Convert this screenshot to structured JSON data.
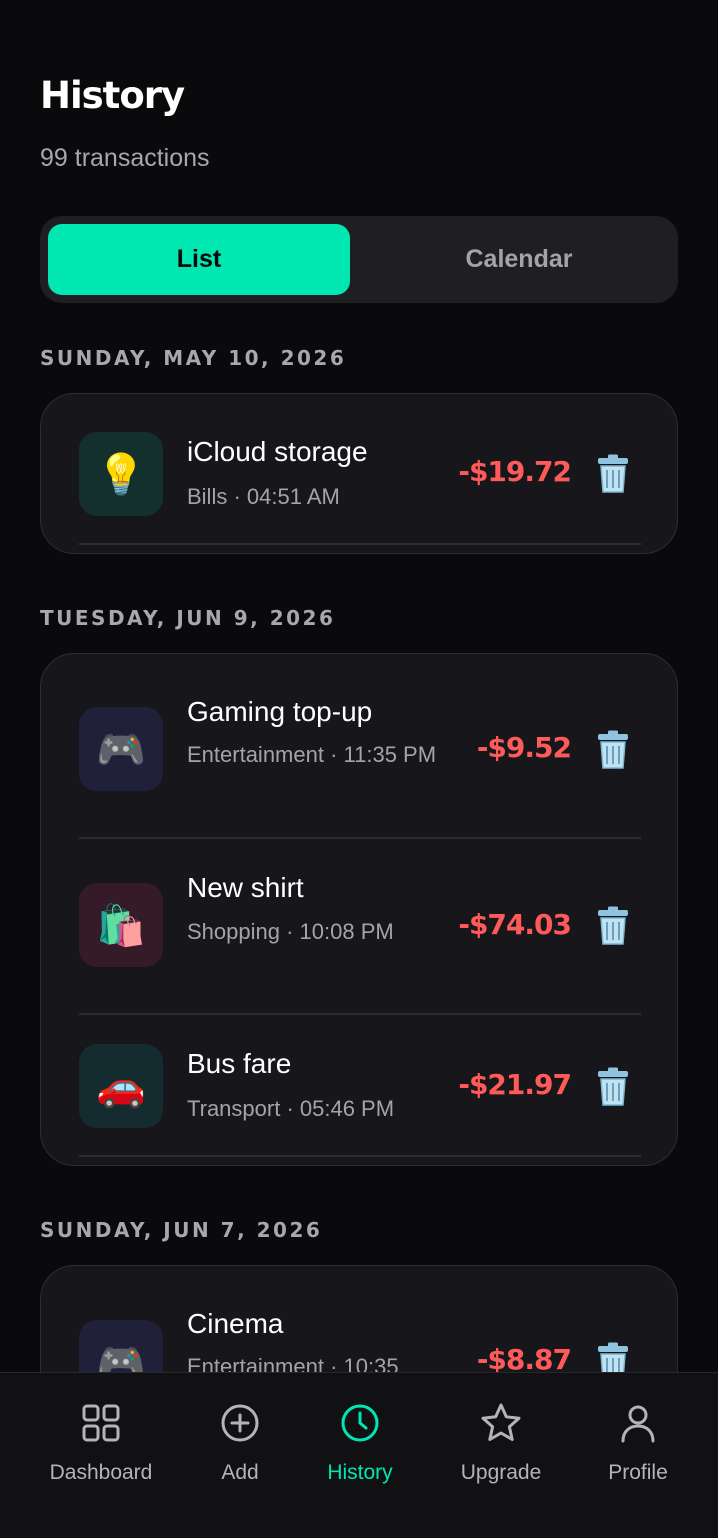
{
  "header": {
    "title": "History",
    "count": "99 transactions"
  },
  "view_toggle": {
    "list_label": "List",
    "calendar_label": "Calendar",
    "selected": "List"
  },
  "groups": [
    {
      "date": "SUNDAY, MAY 10, 2026",
      "items": [
        {
          "icon": "lightbulb-icon",
          "emoji": "💡",
          "title": "iCloud storage",
          "category": "Bills",
          "time": "04:51 AM",
          "subtitle": "Bills · 04:51 AM",
          "amount": "-$19.72"
        }
      ]
    },
    {
      "date": "TUESDAY, JUN 9, 2026",
      "items": [
        {
          "icon": "game-controller-icon",
          "emoji": "🎮",
          "title": "Gaming top-up",
          "category": "Entertainment",
          "time": "11:35 PM",
          "subtitle": "Entertainment · 11:35 PM",
          "amount": "-$9.52"
        },
        {
          "icon": "shopping-bags-icon",
          "emoji": "🛍️",
          "title": "New shirt",
          "category": "Shopping",
          "time": "10:08 PM",
          "subtitle": "Shopping · 10:08 PM",
          "amount": "-$74.03"
        },
        {
          "icon": "car-icon",
          "emoji": "🚗",
          "title": "Bus fare",
          "category": "Transport",
          "time": "05:46 PM",
          "subtitle": "Transport · 05:46 PM",
          "amount": "-$21.97"
        }
      ]
    },
    {
      "date": "SUNDAY, JUN 7, 2026",
      "items": [
        {
          "icon": "game-controller-icon",
          "emoji": "🎮",
          "title": "Cinema",
          "category": "Entertainment",
          "time": "10:35",
          "subtitle": "Entertainment · 10:35",
          "amount": "-$8.87"
        }
      ]
    }
  ],
  "nav": {
    "items": [
      {
        "label": "Dashboard",
        "icon": "grid-icon"
      },
      {
        "label": "Add",
        "icon": "plus-circle-icon"
      },
      {
        "label": "History",
        "icon": "clock-icon",
        "active": true
      },
      {
        "label": "Upgrade",
        "icon": "star-icon"
      },
      {
        "label": "Profile",
        "icon": "user-icon"
      }
    ]
  },
  "colors": {
    "accent": "#00e7b1",
    "expense": "#ff5a5a",
    "background": "#0a0a0c",
    "card": "#17171b"
  }
}
